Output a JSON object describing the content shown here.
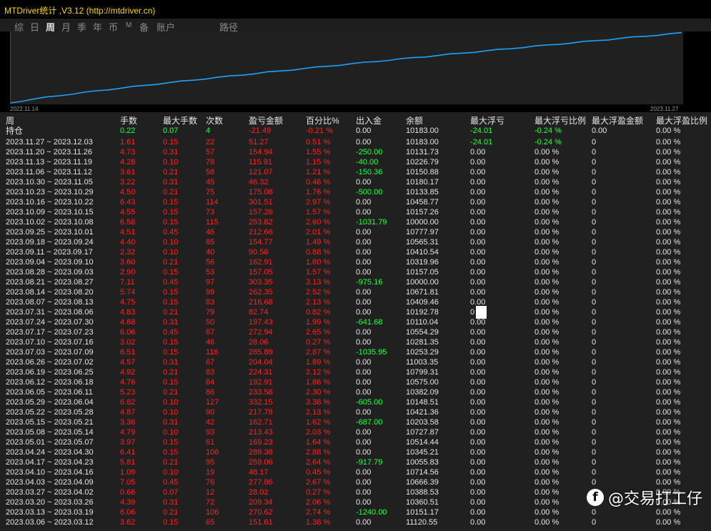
{
  "window": {
    "title": "MTDriver统计 ,V3.12 (http://mtdriver.cn)"
  },
  "tabs": [
    {
      "label": "综"
    },
    {
      "label": "日"
    },
    {
      "label": "周",
      "active": true
    },
    {
      "label": "月"
    },
    {
      "label": "季"
    },
    {
      "label": "年"
    },
    {
      "label": "币"
    },
    {
      "label": "M"
    },
    {
      "label": "备"
    },
    {
      "label": "账户"
    },
    {
      "label": "路径"
    }
  ],
  "chart": {
    "start_date": "2022.11.14",
    "end_date": "2023.11.27",
    "line_color": "#1ea0ff"
  },
  "table": {
    "columns": [
      "周",
      "手数",
      "最大手数",
      "次数",
      "盈亏金额",
      "百分比%",
      "出入金",
      "余额",
      "最大浮亏",
      "最大浮亏比例",
      "最大浮盈金额",
      "最大浮盈比例"
    ],
    "holding": [
      "持仓",
      "0.22",
      "0.07",
      "4",
      "-21.49",
      "-0.21 %",
      "0.00",
      "10183.00",
      "-24.01",
      "-0.24 %",
      "0.00",
      "0.00 %"
    ],
    "rows": [
      [
        "2023.11.27 ~ 2023.12.03",
        "1.61",
        "0.15",
        "22",
        "51.27",
        "0.51 %",
        "0.00",
        "10183.00",
        "-24.01",
        "-0.24 %",
        "0",
        "0.00 %"
      ],
      [
        "2023.11.20 ~ 2023.11.26",
        "4.73",
        "0.31",
        "57",
        "154.94",
        "1.55 %",
        "-250.00",
        "10131.73",
        "0.00",
        "0.00 %",
        "0",
        "0.00 %"
      ],
      [
        "2023.11.13 ~ 2023.11.19",
        "4.28",
        "0.10",
        "78",
        "115.91",
        "1.15 %",
        "-40.00",
        "10226.79",
        "0.00",
        "0.00 %",
        "0",
        "0.00 %"
      ],
      [
        "2023.11.06 ~ 2023.11.12",
        "3.61",
        "0.21",
        "58",
        "121.07",
        "1.21 %",
        "-150.36",
        "10150.88",
        "0.00",
        "0.00 %",
        "0",
        "0.00 %"
      ],
      [
        "2023.10.30 ~ 2023.11.05",
        "3.22",
        "0.31",
        "45",
        "46.32",
        "0.46 %",
        "0.00",
        "10180.17",
        "0.00",
        "0.00 %",
        "0",
        "0.00 %"
      ],
      [
        "2023.10.23 ~ 2023.10.29",
        "4.50",
        "0.21",
        "75",
        "175.08",
        "1.76 %",
        "-500.00",
        "10133.85",
        "0.00",
        "0.00 %",
        "0",
        "0.00 %"
      ],
      [
        "2023.10.16 ~ 2023.10.22",
        "6.43",
        "0.15",
        "114",
        "301.51",
        "2.97 %",
        "0.00",
        "10458.77",
        "0.00",
        "0.00 %",
        "0",
        "0.00 %"
      ],
      [
        "2023.10.09 ~ 2023.10.15",
        "4.55",
        "0.15",
        "73",
        "157.26",
        "1.57 %",
        "0.00",
        "10157.26",
        "0.00",
        "0.00 %",
        "0",
        "0.00 %"
      ],
      [
        "2023.10.02 ~ 2023.10.08",
        "6.58",
        "0.15",
        "115",
        "253.82",
        "2.60 %",
        "-1031.79",
        "10000.00",
        "0.00",
        "0.00 %",
        "0",
        "0.00 %"
      ],
      [
        "2023.09.25 ~ 2023.10.01",
        "4.51",
        "0.45",
        "46",
        "212.66",
        "2.01 %",
        "0.00",
        "10777.97",
        "0.00",
        "0.00 %",
        "0",
        "0.00 %"
      ],
      [
        "2023.09.18 ~ 2023.09.24",
        "4.40",
        "0.10",
        "85",
        "154.77",
        "1.49 %",
        "0.00",
        "10565.31",
        "0.00",
        "0.00 %",
        "0",
        "0.00 %"
      ],
      [
        "2023.09.11 ~ 2023.09.17",
        "2.32",
        "0.10",
        "40",
        "90.58",
        "0.88 %",
        "0.00",
        "10410.54",
        "0.00",
        "0.00 %",
        "0",
        "0.00 %"
      ],
      [
        "2023.09.04 ~ 2023.09.10",
        "3.60",
        "0.21",
        "56",
        "162.91",
        "1.60 %",
        "0.00",
        "10319.96",
        "0.00",
        "0.00 %",
        "0",
        "0.00 %"
      ],
      [
        "2023.08.28 ~ 2023.09.03",
        "2.90",
        "0.15",
        "53",
        "157.05",
        "1.57 %",
        "0.00",
        "10157.05",
        "0.00",
        "0.00 %",
        "0",
        "0.00 %"
      ],
      [
        "2023.08.21 ~ 2023.08.27",
        "7.11",
        "0.45",
        "97",
        "303.35",
        "3.13 %",
        "-975.16",
        "10000.00",
        "0.00",
        "0.00 %",
        "0",
        "0.00 %"
      ],
      [
        "2023.08.14 ~ 2023.08.20",
        "5.74",
        "0.15",
        "99",
        "262.35",
        "2.52 %",
        "0.00",
        "10671.81",
        "0.00",
        "0.00 %",
        "0",
        "0.00 %"
      ],
      [
        "2023.08.07 ~ 2023.08.13",
        "4.75",
        "0.15",
        "83",
        "216.68",
        "2.13 %",
        "0.00",
        "10409.46",
        "0.00",
        "0.00 %",
        "0",
        "0.00 %"
      ],
      [
        "2023.07.31 ~ 2023.08.06",
        "4.83",
        "0.21",
        "79",
        "82.74",
        "0.82 %",
        "0.00",
        "10192.78",
        "0",
        "0.00 %",
        "0",
        "0.00 %"
      ],
      [
        "2023.07.24 ~ 2023.07.30",
        "4.68",
        "0.31",
        "50",
        "197.43",
        "1.99 %",
        "-641.68",
        "10110.04",
        "0.00",
        "0.00 %",
        "0",
        "0.00 %"
      ],
      [
        "2023.07.17 ~ 2023.07.23",
        "6.06",
        "0.45",
        "67",
        "272.94",
        "2.65 %",
        "0.00",
        "10554.29",
        "0.00",
        "0.00 %",
        "0",
        "0.00 %"
      ],
      [
        "2023.07.10 ~ 2023.07.16",
        "3.02",
        "0.15",
        "46",
        "28.06",
        "0.27 %",
        "0.00",
        "10281.35",
        "0.00",
        "0.00 %",
        "0",
        "0.00 %"
      ],
      [
        "2023.07.03 ~ 2023.07.09",
        "6.51",
        "0.15",
        "116",
        "285.89",
        "2.87 %",
        "-1035.95",
        "10253.29",
        "0.00",
        "0.00 %",
        "0",
        "0.00 %"
      ],
      [
        "2023.06.26 ~ 2023.07.02",
        "4.57",
        "0.31",
        "67",
        "204.04",
        "1.89 %",
        "0.00",
        "11003.35",
        "0.00",
        "0.00 %",
        "0",
        "0.00 %"
      ],
      [
        "2023.06.19 ~ 2023.06.25",
        "4.92",
        "0.21",
        "83",
        "224.31",
        "2.12 %",
        "0.00",
        "10799.31",
        "0.00",
        "0.00 %",
        "0",
        "0.00 %"
      ],
      [
        "2023.06.12 ~ 2023.06.18",
        "4.76",
        "0.15",
        "84",
        "192.91",
        "1.86 %",
        "0.00",
        "10575.00",
        "0.00",
        "0.00 %",
        "0",
        "0.00 %"
      ],
      [
        "2023.06.05 ~ 2023.06.11",
        "5.23",
        "0.21",
        "86",
        "233.58",
        "2.30 %",
        "0.00",
        "10382.09",
        "0.00",
        "0.00 %",
        "0",
        "0.00 %"
      ],
      [
        "2023.05.29 ~ 2023.06.04",
        "6.82",
        "0.10",
        "127",
        "332.15",
        "3.38 %",
        "-605.00",
        "10148.51",
        "0.00",
        "0.00 %",
        "0",
        "0.00 %"
      ],
      [
        "2023.05.22 ~ 2023.05.28",
        "4.87",
        "0.10",
        "90",
        "217.78",
        "2.13 %",
        "0.00",
        "10421.36",
        "0.00",
        "0.00 %",
        "0",
        "0.00 %"
      ],
      [
        "2023.05.15 ~ 2023.05.21",
        "3.36",
        "0.31",
        "42",
        "162.71",
        "1.62 %",
        "-687.00",
        "10203.58",
        "0.00",
        "0.00 %",
        "0",
        "0.00 %"
      ],
      [
        "2023.05.08 ~ 2023.05.14",
        "4.79",
        "0.10",
        "93",
        "213.43",
        "2.03 %",
        "0.00",
        "10727.87",
        "0.00",
        "0.00 %",
        "0",
        "0.00 %"
      ],
      [
        "2023.05.01 ~ 2023.05.07",
        "3.97",
        "0.15",
        "61",
        "169.23",
        "1.64 %",
        "0.00",
        "10514.44",
        "0.00",
        "0.00 %",
        "0",
        "0.00 %"
      ],
      [
        "2023.04.24 ~ 2023.04.30",
        "6.41",
        "0.15",
        "106",
        "289.38",
        "2.88 %",
        "0.00",
        "10345.21",
        "0.00",
        "0.00 %",
        "0",
        "0.00 %"
      ],
      [
        "2023.04.17 ~ 2023.04.23",
        "5.81",
        "0.21",
        "95",
        "259.06",
        "2.64 %",
        "-917.79",
        "10055.83",
        "0.00",
        "0.00 %",
        "0",
        "0.00 %"
      ],
      [
        "2023.04.10 ~ 2023.04.16",
        "1.09",
        "0.10",
        "19",
        "48.17",
        "0.45 %",
        "0.00",
        "10714.56",
        "0.00",
        "0.00 %",
        "0",
        "0.00 %"
      ],
      [
        "2023.04.03 ~ 2023.04.09",
        "7.05",
        "0.45",
        "76",
        "277.86",
        "2.67 %",
        "0.00",
        "10666.39",
        "0.00",
        "0.00 %",
        "0",
        "0.00 %"
      ],
      [
        "2023.03.27 ~ 2023.04.02",
        "0.66",
        "0.07",
        "12",
        "28.02",
        "0.27 %",
        "0.00",
        "10388.53",
        "0.00",
        "0.00 %",
        "0",
        "0.00 %"
      ],
      [
        "2023.03.20 ~ 2023.03.26",
        "4.39",
        "0.31",
        "72",
        "209.34",
        "2.06 %",
        "0.00",
        "10360.51",
        "0.00",
        "0.00 %",
        "0",
        "0.00 %"
      ],
      [
        "2023.03.13 ~ 2023.03.19",
        "6.06",
        "0.21",
        "106",
        "270.62",
        "2.74 %",
        "-1240.00",
        "10151.17",
        "0.00",
        "0.00 %",
        "0",
        "0.00 %"
      ],
      [
        "2023.03.06 ~ 2023.03.12",
        "3.62",
        "0.15",
        "65",
        "151.61",
        "1.38 %",
        "0.00",
        "11120.55",
        "0.00",
        "0.00 %",
        "0",
        "0.00 %"
      ]
    ]
  },
  "watermark": {
    "text": "@交易打工仔",
    "icon": "social-logo"
  }
}
